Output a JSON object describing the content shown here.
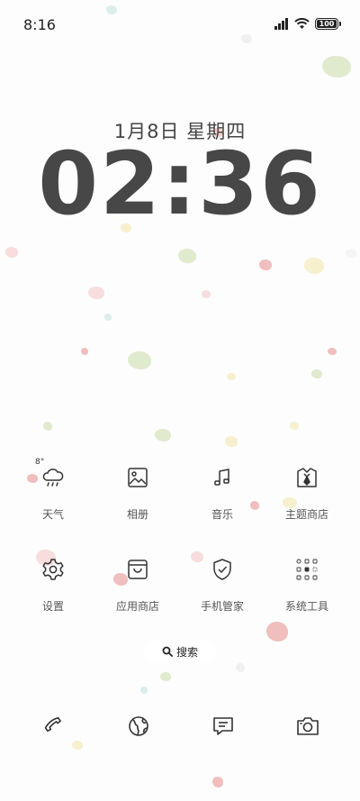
{
  "status_bar": {
    "time": "8:16",
    "battery": "100",
    "battery_level_percent": 100
  },
  "lock": {
    "date": "1月8日 星期四",
    "time": "02:36"
  },
  "apps": [
    {
      "label": "天气",
      "icon": "weather-cloud-rain-icon",
      "temp": "8°"
    },
    {
      "label": "相册",
      "icon": "gallery-image-icon"
    },
    {
      "label": "音乐",
      "icon": "music-note-icon"
    },
    {
      "label": "主题商店",
      "icon": "theme-store-shirt-icon"
    },
    {
      "label": "设置",
      "icon": "gear-icon"
    },
    {
      "label": "应用商店",
      "icon": "app-store-bag-icon"
    },
    {
      "label": "手机管家",
      "icon": "shield-check-icon"
    },
    {
      "label": "系统工具",
      "icon": "folder-grid-icon"
    }
  ],
  "search": {
    "label": "搜索"
  },
  "dock": [
    {
      "name": "phone",
      "icon": "phone-icon"
    },
    {
      "name": "browser",
      "icon": "globe-icon"
    },
    {
      "name": "messages",
      "icon": "message-icon"
    },
    {
      "name": "camera",
      "icon": "camera-icon"
    }
  ],
  "colors": {
    "wallpaper_dots": [
      "#e88a8a",
      "#c9dba6",
      "#f0e6a8",
      "#9fd3d9",
      "#f2c2c2"
    ]
  }
}
